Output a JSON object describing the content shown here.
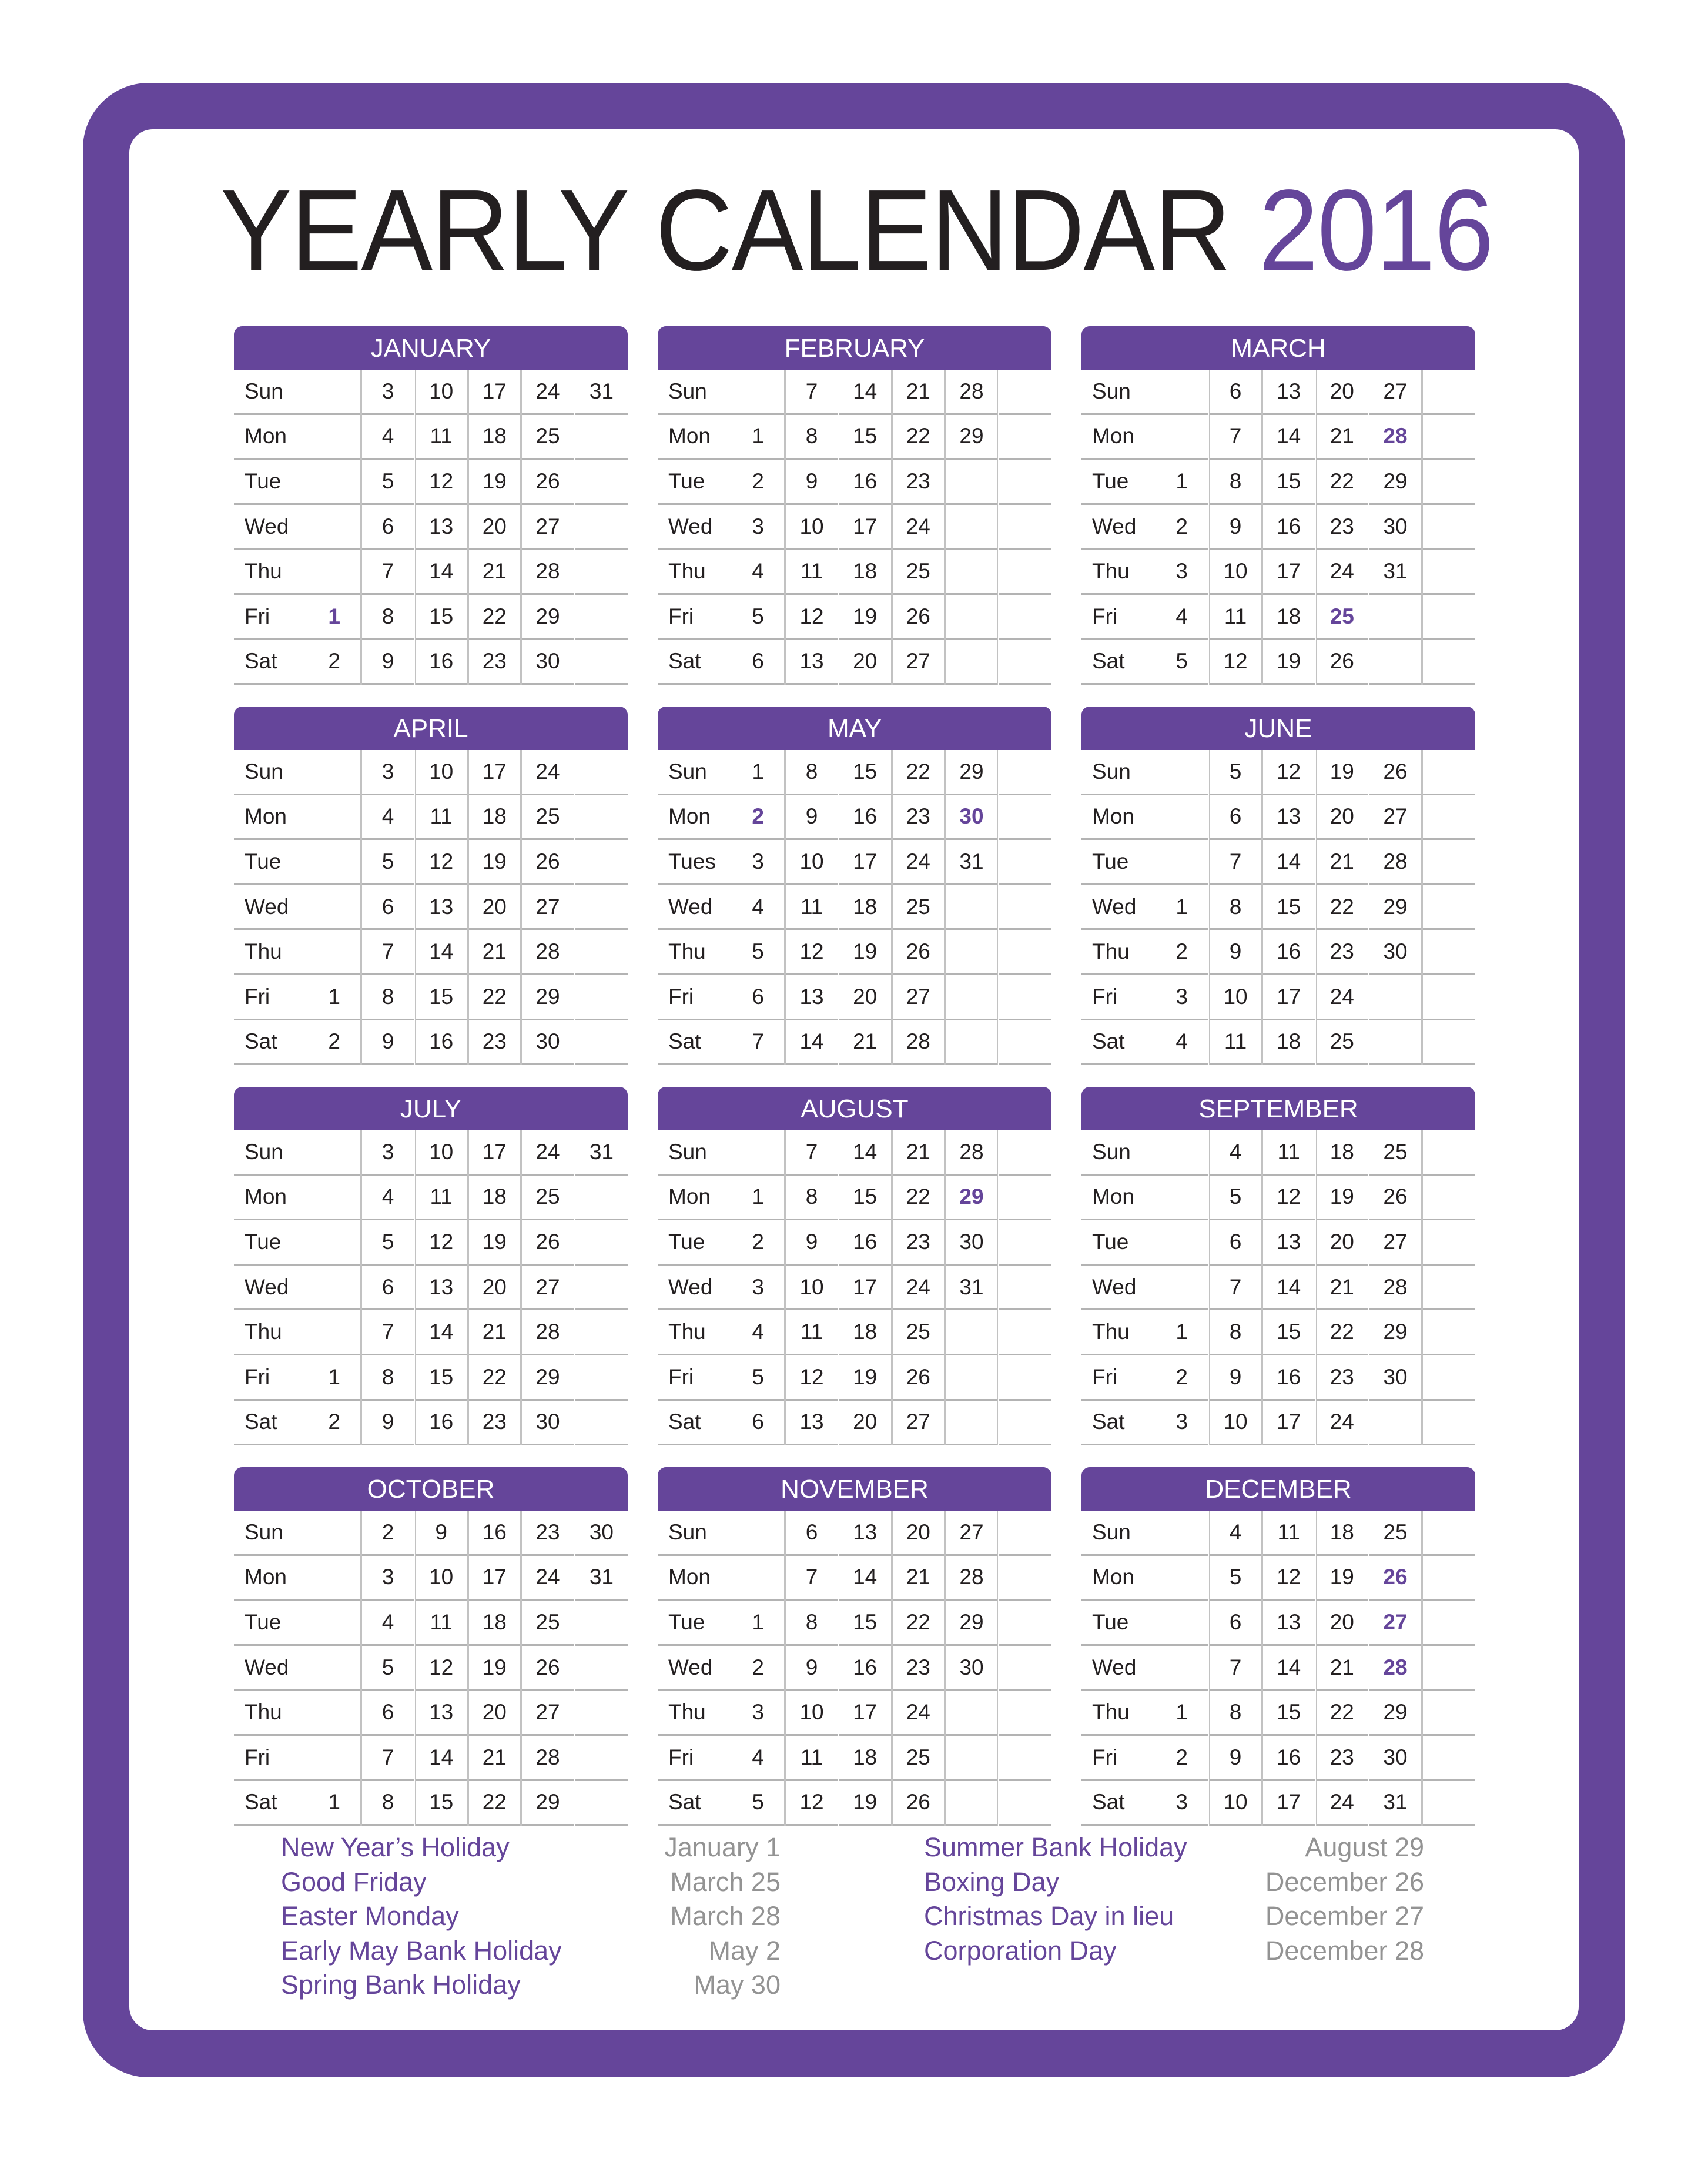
{
  "title": {
    "main": "YEARLY CALENDAR",
    "year": "2016"
  },
  "colors": {
    "accent": "#65459a",
    "text": "#231f20",
    "date_gray": "#939393",
    "rule": "#b3b3b3"
  },
  "months": [
    {
      "name": "JANUARY",
      "rows": [
        {
          "day": "Sun",
          "cells": [
            "",
            "3",
            "10",
            "17",
            "24",
            "31"
          ]
        },
        {
          "day": "Mon",
          "cells": [
            "",
            "4",
            "11",
            "18",
            "25",
            ""
          ]
        },
        {
          "day": "Tue",
          "cells": [
            "",
            "5",
            "12",
            "19",
            "26",
            ""
          ]
        },
        {
          "day": "Wed",
          "cells": [
            "",
            "6",
            "13",
            "20",
            "27",
            ""
          ]
        },
        {
          "day": "Thu",
          "cells": [
            "",
            "7",
            "14",
            "21",
            "28",
            ""
          ]
        },
        {
          "day": "Fri",
          "cells": [
            "1",
            "8",
            "15",
            "22",
            "29",
            ""
          ]
        },
        {
          "day": "Sat",
          "cells": [
            "2",
            "9",
            "16",
            "23",
            "30",
            ""
          ]
        }
      ],
      "holidays": [
        "1"
      ]
    },
    {
      "name": "FEBRUARY",
      "rows": [
        {
          "day": "Sun",
          "cells": [
            "",
            "7",
            "14",
            "21",
            "28",
            ""
          ]
        },
        {
          "day": "Mon",
          "cells": [
            "1",
            "8",
            "15",
            "22",
            "29",
            ""
          ]
        },
        {
          "day": "Tue",
          "cells": [
            "2",
            "9",
            "16",
            "23",
            "",
            ""
          ]
        },
        {
          "day": "Wed",
          "cells": [
            "3",
            "10",
            "17",
            "24",
            "",
            ""
          ]
        },
        {
          "day": "Thu",
          "cells": [
            "4",
            "11",
            "18",
            "25",
            "",
            ""
          ]
        },
        {
          "day": "Fri",
          "cells": [
            "5",
            "12",
            "19",
            "26",
            "",
            ""
          ]
        },
        {
          "day": "Sat",
          "cells": [
            "6",
            "13",
            "20",
            "27",
            "",
            ""
          ]
        }
      ],
      "holidays": []
    },
    {
      "name": "MARCH",
      "rows": [
        {
          "day": "Sun",
          "cells": [
            "",
            "6",
            "13",
            "20",
            "27",
            ""
          ]
        },
        {
          "day": "Mon",
          "cells": [
            "",
            "7",
            "14",
            "21",
            "28",
            ""
          ]
        },
        {
          "day": "Tue",
          "cells": [
            "1",
            "8",
            "15",
            "22",
            "29",
            ""
          ]
        },
        {
          "day": "Wed",
          "cells": [
            "2",
            "9",
            "16",
            "23",
            "30",
            ""
          ]
        },
        {
          "day": "Thu",
          "cells": [
            "3",
            "10",
            "17",
            "24",
            "31",
            ""
          ]
        },
        {
          "day": "Fri",
          "cells": [
            "4",
            "11",
            "18",
            "25",
            "",
            ""
          ]
        },
        {
          "day": "Sat",
          "cells": [
            "5",
            "12",
            "19",
            "26",
            "",
            ""
          ]
        }
      ],
      "holidays": [
        "25",
        "28"
      ]
    },
    {
      "name": "APRIL",
      "rows": [
        {
          "day": "Sun",
          "cells": [
            "",
            "3",
            "10",
            "17",
            "24",
            ""
          ]
        },
        {
          "day": "Mon",
          "cells": [
            "",
            "4",
            "11",
            "18",
            "25",
            ""
          ]
        },
        {
          "day": "Tue",
          "cells": [
            "",
            "5",
            "12",
            "19",
            "26",
            ""
          ]
        },
        {
          "day": "Wed",
          "cells": [
            "",
            "6",
            "13",
            "20",
            "27",
            ""
          ]
        },
        {
          "day": "Thu",
          "cells": [
            "",
            "7",
            "14",
            "21",
            "28",
            ""
          ]
        },
        {
          "day": "Fri",
          "cells": [
            "1",
            "8",
            "15",
            "22",
            "29",
            ""
          ]
        },
        {
          "day": "Sat",
          "cells": [
            "2",
            "9",
            "16",
            "23",
            "30",
            ""
          ]
        }
      ],
      "holidays": []
    },
    {
      "name": "MAY",
      "rows": [
        {
          "day": "Sun",
          "cells": [
            "1",
            "8",
            "15",
            "22",
            "29",
            ""
          ]
        },
        {
          "day": "Mon",
          "cells": [
            "2",
            "9",
            "16",
            "23",
            "30",
            ""
          ]
        },
        {
          "day": "Tues",
          "cells": [
            "3",
            "10",
            "17",
            "24",
            "31",
            ""
          ]
        },
        {
          "day": "Wed",
          "cells": [
            "4",
            "11",
            "18",
            "25",
            "",
            ""
          ]
        },
        {
          "day": "Thu",
          "cells": [
            "5",
            "12",
            "19",
            "26",
            "",
            ""
          ]
        },
        {
          "day": "Fri",
          "cells": [
            "6",
            "13",
            "20",
            "27",
            "",
            ""
          ]
        },
        {
          "day": "Sat",
          "cells": [
            "7",
            "14",
            "21",
            "28",
            "",
            ""
          ]
        }
      ],
      "holidays": [
        "2",
        "30"
      ]
    },
    {
      "name": "JUNE",
      "rows": [
        {
          "day": "Sun",
          "cells": [
            "",
            "5",
            "12",
            "19",
            "26",
            ""
          ]
        },
        {
          "day": "Mon",
          "cells": [
            "",
            "6",
            "13",
            "20",
            "27",
            ""
          ]
        },
        {
          "day": "Tue",
          "cells": [
            "",
            "7",
            "14",
            "21",
            "28",
            ""
          ]
        },
        {
          "day": "Wed",
          "cells": [
            "1",
            "8",
            "15",
            "22",
            "29",
            ""
          ]
        },
        {
          "day": "Thu",
          "cells": [
            "2",
            "9",
            "16",
            "23",
            "30",
            ""
          ]
        },
        {
          "day": "Fri",
          "cells": [
            "3",
            "10",
            "17",
            "24",
            "",
            ""
          ]
        },
        {
          "day": "Sat",
          "cells": [
            "4",
            "11",
            "18",
            "25",
            "",
            ""
          ]
        }
      ],
      "holidays": []
    },
    {
      "name": "JULY",
      "rows": [
        {
          "day": "Sun",
          "cells": [
            "",
            "3",
            "10",
            "17",
            "24",
            "31"
          ]
        },
        {
          "day": "Mon",
          "cells": [
            "",
            "4",
            "11",
            "18",
            "25",
            ""
          ]
        },
        {
          "day": "Tue",
          "cells": [
            "",
            "5",
            "12",
            "19",
            "26",
            ""
          ]
        },
        {
          "day": "Wed",
          "cells": [
            "",
            "6",
            "13",
            "20",
            "27",
            ""
          ]
        },
        {
          "day": "Thu",
          "cells": [
            "",
            "7",
            "14",
            "21",
            "28",
            ""
          ]
        },
        {
          "day": "Fri",
          "cells": [
            "1",
            "8",
            "15",
            "22",
            "29",
            ""
          ]
        },
        {
          "day": "Sat",
          "cells": [
            "2",
            "9",
            "16",
            "23",
            "30",
            ""
          ]
        }
      ],
      "holidays": []
    },
    {
      "name": "AUGUST",
      "rows": [
        {
          "day": "Sun",
          "cells": [
            "",
            "7",
            "14",
            "21",
            "28",
            ""
          ]
        },
        {
          "day": "Mon",
          "cells": [
            "1",
            "8",
            "15",
            "22",
            "29",
            ""
          ]
        },
        {
          "day": "Tue",
          "cells": [
            "2",
            "9",
            "16",
            "23",
            "30",
            ""
          ]
        },
        {
          "day": "Wed",
          "cells": [
            "3",
            "10",
            "17",
            "24",
            "31",
            ""
          ]
        },
        {
          "day": "Thu",
          "cells": [
            "4",
            "11",
            "18",
            "25",
            "",
            ""
          ]
        },
        {
          "day": "Fri",
          "cells": [
            "5",
            "12",
            "19",
            "26",
            "",
            ""
          ]
        },
        {
          "day": "Sat",
          "cells": [
            "6",
            "13",
            "20",
            "27",
            "",
            ""
          ]
        }
      ],
      "holidays": [
        "29"
      ]
    },
    {
      "name": "SEPTEMBER",
      "rows": [
        {
          "day": "Sun",
          "cells": [
            "",
            "4",
            "11",
            "18",
            "25",
            ""
          ]
        },
        {
          "day": "Mon",
          "cells": [
            "",
            "5",
            "12",
            "19",
            "26",
            ""
          ]
        },
        {
          "day": "Tue",
          "cells": [
            "",
            "6",
            "13",
            "20",
            "27",
            ""
          ]
        },
        {
          "day": "Wed",
          "cells": [
            "",
            "7",
            "14",
            "21",
            "28",
            ""
          ]
        },
        {
          "day": "Thu",
          "cells": [
            "1",
            "8",
            "15",
            "22",
            "29",
            ""
          ]
        },
        {
          "day": "Fri",
          "cells": [
            "2",
            "9",
            "16",
            "23",
            "30",
            ""
          ]
        },
        {
          "day": "Sat",
          "cells": [
            "3",
            "10",
            "17",
            "24",
            "",
            ""
          ]
        }
      ],
      "holidays": []
    },
    {
      "name": "OCTOBER",
      "rows": [
        {
          "day": "Sun",
          "cells": [
            "",
            "2",
            "9",
            "16",
            "23",
            "30"
          ]
        },
        {
          "day": "Mon",
          "cells": [
            "",
            "3",
            "10",
            "17",
            "24",
            "31"
          ]
        },
        {
          "day": "Tue",
          "cells": [
            "",
            "4",
            "11",
            "18",
            "25",
            ""
          ]
        },
        {
          "day": "Wed",
          "cells": [
            "",
            "5",
            "12",
            "19",
            "26",
            ""
          ]
        },
        {
          "day": "Thu",
          "cells": [
            "",
            "6",
            "13",
            "20",
            "27",
            ""
          ]
        },
        {
          "day": "Fri",
          "cells": [
            "",
            "7",
            "14",
            "21",
            "28",
            ""
          ]
        },
        {
          "day": "Sat",
          "cells": [
            "1",
            "8",
            "15",
            "22",
            "29",
            ""
          ]
        }
      ],
      "holidays": []
    },
    {
      "name": "NOVEMBER",
      "rows": [
        {
          "day": "Sun",
          "cells": [
            "",
            "6",
            "13",
            "20",
            "27",
            ""
          ]
        },
        {
          "day": "Mon",
          "cells": [
            "",
            "7",
            "14",
            "21",
            "28",
            ""
          ]
        },
        {
          "day": "Tue",
          "cells": [
            "1",
            "8",
            "15",
            "22",
            "29",
            ""
          ]
        },
        {
          "day": "Wed",
          "cells": [
            "2",
            "9",
            "16",
            "23",
            "30",
            ""
          ]
        },
        {
          "day": "Thu",
          "cells": [
            "3",
            "10",
            "17",
            "24",
            "",
            ""
          ]
        },
        {
          "day": "Fri",
          "cells": [
            "4",
            "11",
            "18",
            "25",
            "",
            ""
          ]
        },
        {
          "day": "Sat",
          "cells": [
            "5",
            "12",
            "19",
            "26",
            "",
            ""
          ]
        }
      ],
      "holidays": []
    },
    {
      "name": "DECEMBER",
      "rows": [
        {
          "day": "Sun",
          "cells": [
            "",
            "4",
            "11",
            "18",
            "25",
            ""
          ]
        },
        {
          "day": "Mon",
          "cells": [
            "",
            "5",
            "12",
            "19",
            "26",
            ""
          ]
        },
        {
          "day": "Tue",
          "cells": [
            "",
            "6",
            "13",
            "20",
            "27",
            ""
          ]
        },
        {
          "day": "Wed",
          "cells": [
            "",
            "7",
            "14",
            "21",
            "28",
            ""
          ]
        },
        {
          "day": "Thu",
          "cells": [
            "1",
            "8",
            "15",
            "22",
            "29",
            ""
          ]
        },
        {
          "day": "Fri",
          "cells": [
            "2",
            "9",
            "16",
            "23",
            "30",
            ""
          ]
        },
        {
          "day": "Sat",
          "cells": [
            "3",
            "10",
            "17",
            "24",
            "31",
            ""
          ]
        }
      ],
      "holidays": [
        "26",
        "27",
        "28"
      ]
    }
  ],
  "legend": {
    "left": [
      {
        "name": "New Year’s Holiday",
        "date": "January 1"
      },
      {
        "name": "Good Friday",
        "date": "March 25"
      },
      {
        "name": "Easter Monday",
        "date": "March 28"
      },
      {
        "name": "Early May Bank Holiday",
        "date": "May 2"
      },
      {
        "name": "Spring Bank Holiday",
        "date": "May 30"
      }
    ],
    "right": [
      {
        "name": "Summer Bank Holiday",
        "date": "August 29"
      },
      {
        "name": "Boxing Day",
        "date": "December 26"
      },
      {
        "name": "Christmas Day in lieu",
        "date": "December 27"
      },
      {
        "name": "Corporation Day",
        "date": "December 28"
      }
    ]
  }
}
